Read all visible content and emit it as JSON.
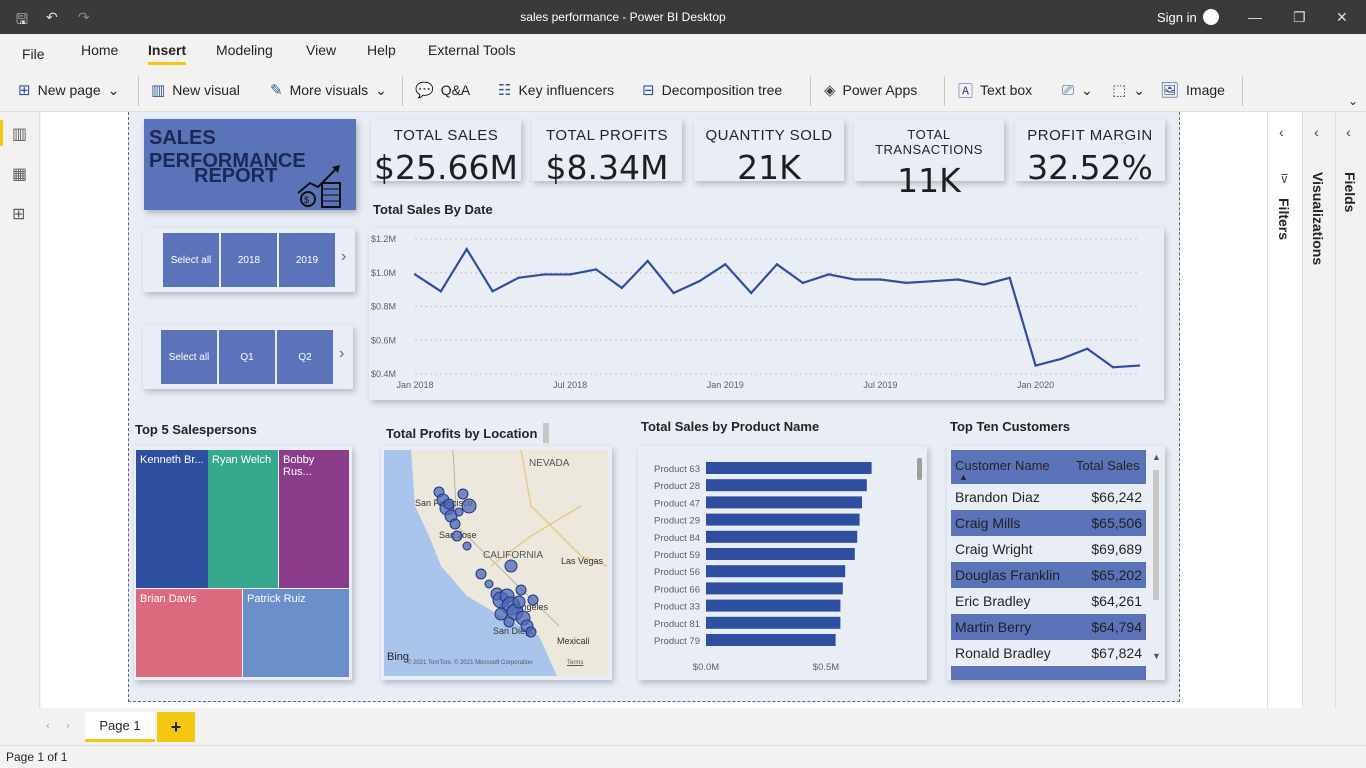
{
  "window": {
    "title": "sales performance - Power BI Desktop",
    "sign_in": "Sign in"
  },
  "menu": {
    "items": [
      "File",
      "Home",
      "Insert",
      "Modeling",
      "View",
      "Help",
      "External Tools"
    ],
    "active": "Insert"
  },
  "ribbon": {
    "new_page": "New page",
    "new_visual": "New visual",
    "more_visuals": "More visuals",
    "qa": "Q&A",
    "key_influencers": "Key influencers",
    "decomposition_tree": "Decomposition tree",
    "power_apps": "Power Apps",
    "text_box": "Text box",
    "image": "Image"
  },
  "report": {
    "title_line1": "SALES PERFORMANCE",
    "title_line2": "REPORT",
    "cards": [
      {
        "title": "TOTAL SALES",
        "value": "$25.66M"
      },
      {
        "title": "TOTAL PROFITS",
        "value": "$8.34M"
      },
      {
        "title": "QUANTITY SOLD",
        "value": "21K"
      },
      {
        "title": "TOTAL TRANSACTIONS",
        "value": "11K"
      },
      {
        "title": "PROFIT MARGIN",
        "value": "32.52%"
      }
    ],
    "year_slicer": [
      "Select all",
      "2018",
      "2019"
    ],
    "quarter_slicer": [
      "Select all",
      "Q1",
      "Q2"
    ],
    "line_title": "Total Sales By Date",
    "treemap_title": "Top 5 Salespersons",
    "treemap": [
      {
        "name": "Kenneth Br...",
        "color": "#2e4ea0"
      },
      {
        "name": "Ryan Welch",
        "color": "#36a88e"
      },
      {
        "name": "Bobby Rus...",
        "color": "#8b3d8c"
      },
      {
        "name": "Brian Davis",
        "color": "#dc6b80"
      },
      {
        "name": "Patrick Ruiz",
        "color": "#6b8fcb"
      }
    ],
    "map_title": "Total Profits by Location",
    "map_labels": {
      "nevada": "NEVADA",
      "california": "CALIFORNIA",
      "las_vegas": "Las Vegas",
      "san_francisco": "San Francisco",
      "san_jose": "San Jose",
      "los_angeles": "Los Angeles",
      "san_diego": "San Diego",
      "mexicali": "Mexicali",
      "bing": "Bing",
      "copyright": "© 2021 TomTom, © 2021 Microsoft Corporation",
      "terms": "Terms"
    },
    "bar_title": "Total Sales by Product Name",
    "customers_title": "Top Ten Customers",
    "customers_headers": [
      "Customer Name",
      "Total Sales"
    ],
    "customers": [
      {
        "name": "Brandon Diaz",
        "sales": "$66,242"
      },
      {
        "name": "Craig Mills",
        "sales": "$65,506"
      },
      {
        "name": "Craig Wright",
        "sales": "$69,689"
      },
      {
        "name": "Douglas Franklin",
        "sales": "$65,202"
      },
      {
        "name": "Eric Bradley",
        "sales": "$64,261"
      },
      {
        "name": "Martin Berry",
        "sales": "$64,794"
      },
      {
        "name": "Ronald Bradley",
        "sales": "$67,824"
      }
    ]
  },
  "panes": {
    "filters": "Filters",
    "visualizations": "Visualizations",
    "fields": "Fields"
  },
  "page_tabs": {
    "current": "Page 1",
    "add": "+"
  },
  "status": {
    "page": "Page 1 of 1"
  },
  "chart_data": [
    {
      "type": "line",
      "title": "Total Sales By Date",
      "x": [
        "2018-01",
        "2018-02",
        "2018-03",
        "2018-04",
        "2018-05",
        "2018-06",
        "2018-07",
        "2018-08",
        "2018-09",
        "2018-10",
        "2018-11",
        "2018-12",
        "2019-01",
        "2019-02",
        "2019-03",
        "2019-04",
        "2019-05",
        "2019-06",
        "2019-07",
        "2019-08",
        "2019-09",
        "2019-10",
        "2019-11",
        "2019-12",
        "2020-01",
        "2020-02",
        "2020-03",
        "2020-04",
        "2020-05"
      ],
      "values": [
        0.99,
        0.89,
        1.14,
        0.89,
        0.97,
        0.99,
        0.99,
        1.02,
        0.91,
        1.07,
        0.88,
        0.95,
        1.05,
        0.88,
        1.05,
        0.94,
        0.99,
        0.96,
        0.96,
        0.94,
        0.95,
        0.96,
        0.93,
        0.97,
        0.45,
        0.49,
        0.55,
        0.44,
        0.45
      ],
      "x_ticks": [
        "Jan 2018",
        "Jul 2018",
        "Jan 2019",
        "Jul 2019",
        "Jan 2020"
      ],
      "y_ticks": [
        "$0.4M",
        "$0.6M",
        "$0.8M",
        "$1.0M",
        "$1.2M"
      ],
      "ylim": [
        0.4,
        1.2
      ],
      "color": "#2e4ea0"
    },
    {
      "type": "bar",
      "title": "Total Sales by Product Name",
      "categories": [
        "Product 63",
        "Product 28",
        "Product 47",
        "Product 29",
        "Product 84",
        "Product 59",
        "Product 56",
        "Product 66",
        "Product 33",
        "Product 81",
        "Product 79"
      ],
      "values": [
        0.69,
        0.67,
        0.65,
        0.64,
        0.63,
        0.62,
        0.58,
        0.57,
        0.56,
        0.56,
        0.54
      ],
      "x_ticks": [
        "$0.0M",
        "$0.5M"
      ],
      "xlim": [
        0,
        0.8
      ],
      "color": "#2e4ea0"
    }
  ]
}
